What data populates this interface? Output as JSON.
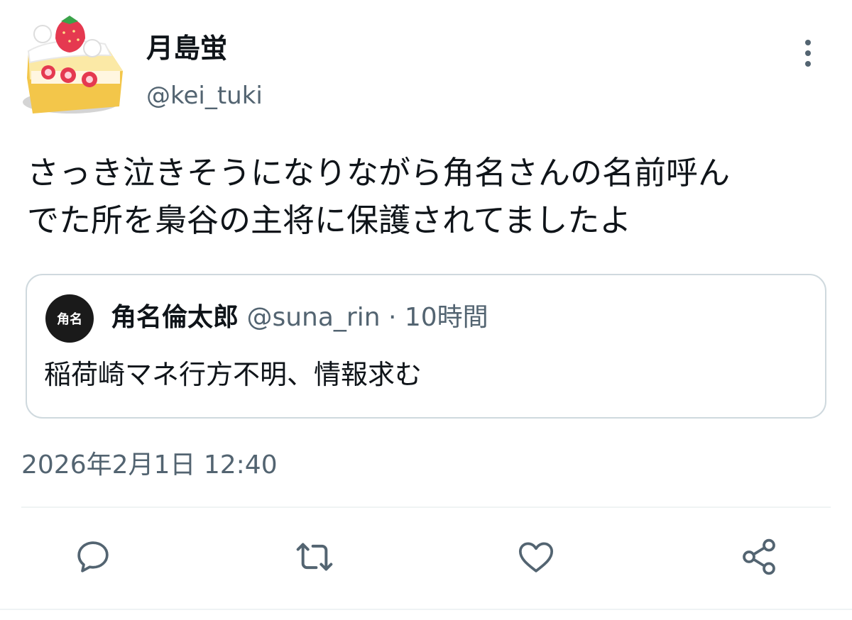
{
  "tweet": {
    "author": {
      "display_name": "月島蛍",
      "handle": "@kei_tuki",
      "avatar_icon": "strawberry-shortcake-icon"
    },
    "text": "さっき泣きそうになりながら角名さんの名前呼ん\nでた所を梟谷の主将に保護されてましたよ",
    "timestamp": "2026年2月1日 12:40",
    "more_icon": "more-vertical-icon"
  },
  "quote": {
    "avatar_text": "角名",
    "display_name": "角名倫太郎",
    "meta": "@suna_rin · 10時間",
    "text": "稲荷崎マネ行方不明、情報求む"
  },
  "actions": [
    {
      "name": "reply",
      "icon": "comment-icon"
    },
    {
      "name": "retweet",
      "icon": "retweet-icon"
    },
    {
      "name": "like",
      "icon": "heart-icon"
    },
    {
      "name": "share",
      "icon": "share-icon"
    }
  ],
  "colors": {
    "text": "#0f1419",
    "secondary": "#536471",
    "border": "#cfd9de",
    "divider": "#eff3f4"
  }
}
